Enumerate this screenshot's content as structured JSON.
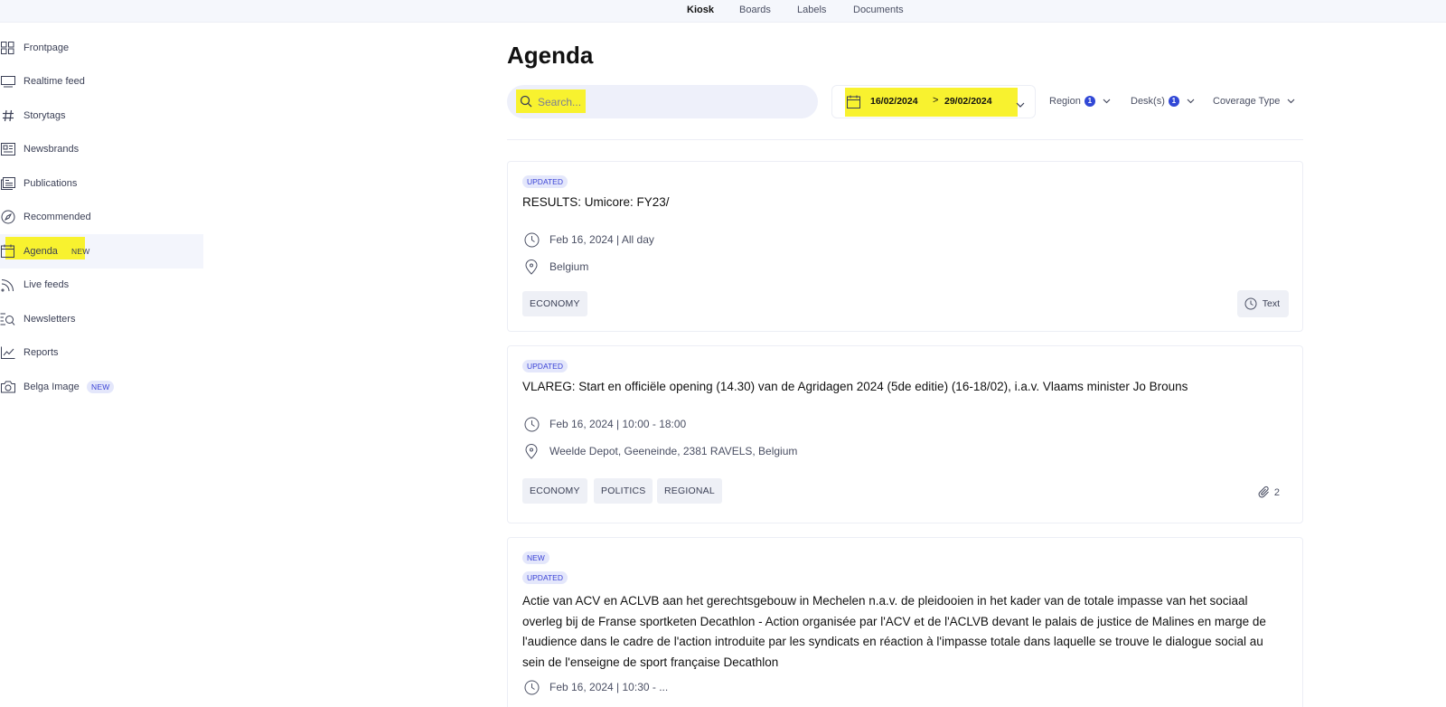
{
  "topnav": {
    "tabs": [
      {
        "label": "Kiosk",
        "active": true
      },
      {
        "label": "Boards",
        "active": false
      },
      {
        "label": "Labels",
        "active": false
      },
      {
        "label": "Documents",
        "active": false
      }
    ]
  },
  "sidebar": {
    "items": [
      {
        "label": "Frontpage",
        "icon": "grid-icon"
      },
      {
        "label": "Realtime feed",
        "icon": "monitor-icon"
      },
      {
        "label": "Storytags",
        "icon": "hash-icon"
      },
      {
        "label": "Newsbrands",
        "icon": "newspaper-icon"
      },
      {
        "label": "Publications",
        "icon": "publications-icon"
      },
      {
        "label": "Recommended",
        "icon": "compass-icon"
      },
      {
        "label": "Agenda",
        "icon": "calendar-icon",
        "badge": "NEW",
        "active": true
      },
      {
        "label": "Live feeds",
        "icon": "rss-icon"
      },
      {
        "label": "Newsletters",
        "icon": "newsletter-search-icon"
      },
      {
        "label": "Reports",
        "icon": "chart-line-icon"
      },
      {
        "label": "Belga Image",
        "icon": "camera-icon",
        "badge": "NEW"
      }
    ]
  },
  "main": {
    "title": "Agenda",
    "search": {
      "placeholder": "Search..."
    },
    "date_range": {
      "start": "16/02/2024",
      "separator": ">",
      "end": "29/02/2024"
    },
    "filters": [
      {
        "label": "Region",
        "count": "1"
      },
      {
        "label": "Desk(s)",
        "count": "1"
      },
      {
        "label": "Coverage Type"
      }
    ],
    "events": [
      {
        "statuses": [
          "UPDATED"
        ],
        "title": "RESULTS: Umicore: FY23/",
        "datetime": "Feb 16, 2024 | All day",
        "location": "Belgium",
        "tags": [
          "ECONOMY"
        ],
        "coverage": "Text"
      },
      {
        "statuses": [
          "UPDATED"
        ],
        "title": "VLAREG: Start en officiële opening (14.30) van de Agridagen 2024 (5de editie) (16-18/02), i.a.v. Vlaams minister Jo Brouns",
        "datetime": "Feb 16, 2024 | 10:00 - 18:00",
        "location": "Weelde Depot, Geeneinde, 2381 RAVELS, Belgium",
        "tags": [
          "ECONOMY",
          "POLITICS",
          "REGIONAL"
        ],
        "attachments": "2"
      },
      {
        "statuses": [
          "NEW",
          "UPDATED"
        ],
        "title": "Actie van ACV en ACLVB aan het gerechtsgebouw in Mechelen n.a.v. de pleidooien in het kader van de totale impasse van het sociaal overleg bij de Franse sportketen Decathlon - Action organisée par l'ACV et de l'ACLVB devant le palais de justice de Malines en marge de l'audience dans le cadre de l'action introduite par les syndicats en réaction à l'impasse totale dans laquelle se trouve le dialogue social au sein de l'enseigne de sport française Decathlon",
        "datetime": "Feb 16, 2024 | 10:30 - ..."
      }
    ]
  },
  "colors": {
    "highlight": "#f8f22f",
    "accent": "#3148d6",
    "badge_bg": "#e4e7fb",
    "badge_text": "#3b43d6"
  }
}
